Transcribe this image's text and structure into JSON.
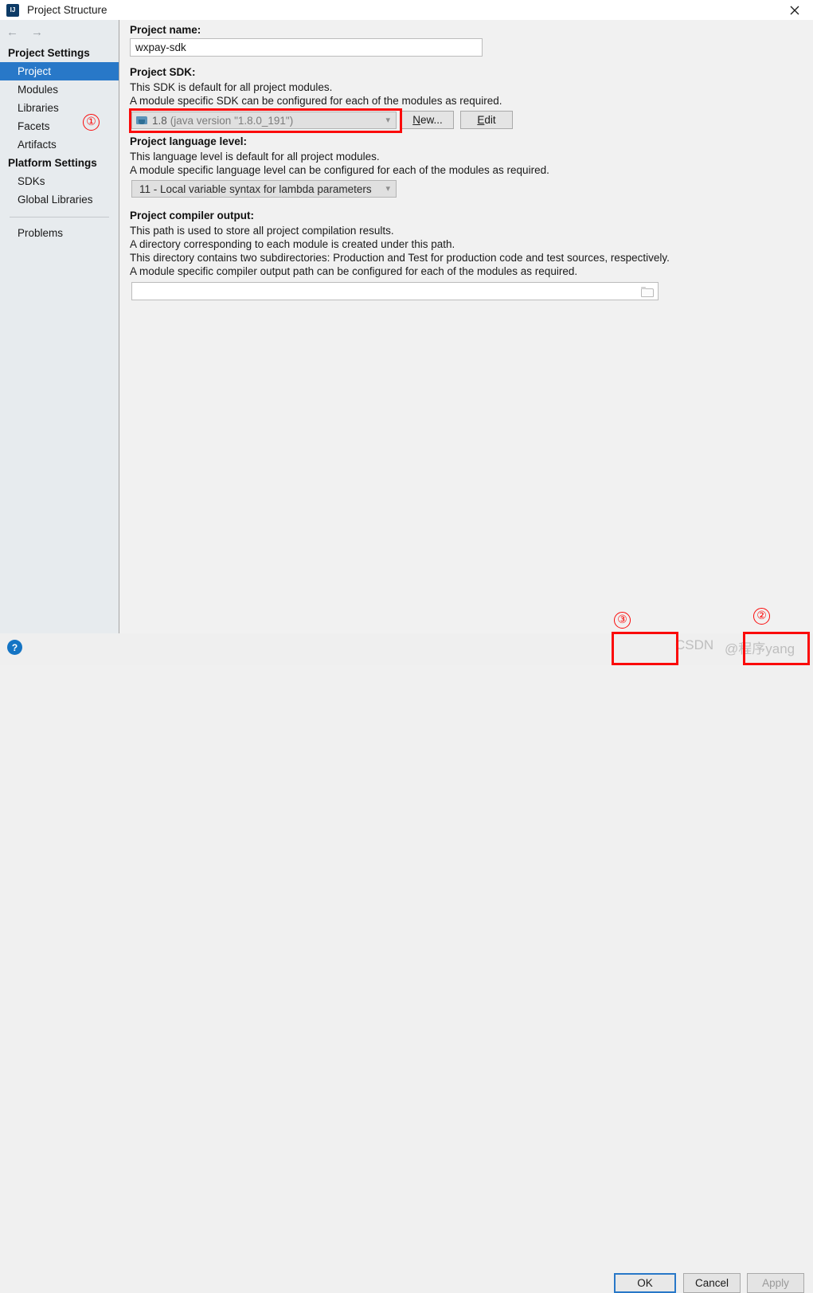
{
  "window": {
    "title": "Project Structure",
    "app_icon": "intellij-idea-icon",
    "close_icon": "close-icon"
  },
  "nav": {
    "back_icon": "arrow-left-icon",
    "forward_icon": "arrow-right-icon"
  },
  "sidebar": {
    "groups": [
      {
        "label": "Project Settings",
        "items": [
          {
            "label": "Project",
            "selected": true
          },
          {
            "label": "Modules",
            "selected": false
          },
          {
            "label": "Libraries",
            "selected": false
          },
          {
            "label": "Facets",
            "selected": false
          },
          {
            "label": "Artifacts",
            "selected": false
          }
        ]
      },
      {
        "label": "Platform Settings",
        "items": [
          {
            "label": "SDKs",
            "selected": false
          },
          {
            "label": "Global Libraries",
            "selected": false
          }
        ]
      }
    ],
    "problems": "Problems"
  },
  "main": {
    "project_name": {
      "label": "Project name:",
      "value": "wxpay-sdk"
    },
    "project_sdk": {
      "label": "Project SDK:",
      "desc1": "This SDK is default for all project modules.",
      "desc2": "A module specific SDK can be configured for each of the modules as required.",
      "selected_version": "1.8",
      "selected_detail": "(java version \"1.8.0_191\")",
      "sdk_icon": "java-sdk-icon",
      "dropdown_icon": "chevron-down-icon",
      "new_button": "New...",
      "new_button_mnemonic": "N",
      "edit_button": "Edit",
      "edit_button_mnemonic": "E"
    },
    "language_level": {
      "label": "Project language level:",
      "desc1": "This language level is default for all project modules.",
      "desc2": "A module specific language level can be configured for each of the modules as required.",
      "selected": "11 - Local variable syntax for lambda parameters",
      "dropdown_icon": "chevron-down-icon"
    },
    "compiler_output": {
      "label": "Project compiler output:",
      "desc1": "This path is used to store all project compilation results.",
      "desc2": "A directory corresponding to each module is created under this path.",
      "desc3": "This directory contains two subdirectories: Production and Test for production code and test sources, respectively.",
      "desc4": "A module specific compiler output path can be configured for each of the modules as required.",
      "value": "",
      "browse_icon": "folder-icon"
    }
  },
  "footer": {
    "help_icon": "help-question-icon",
    "ok_button": "OK",
    "cancel_button": "Cancel",
    "apply_button": "Apply"
  },
  "annotations": {
    "marker_1": "①",
    "marker_2": "②",
    "marker_3": "③",
    "color": "#fb0a0a"
  },
  "watermark": {
    "text_csdn": "CSDN",
    "text_author": "@程序yang"
  }
}
